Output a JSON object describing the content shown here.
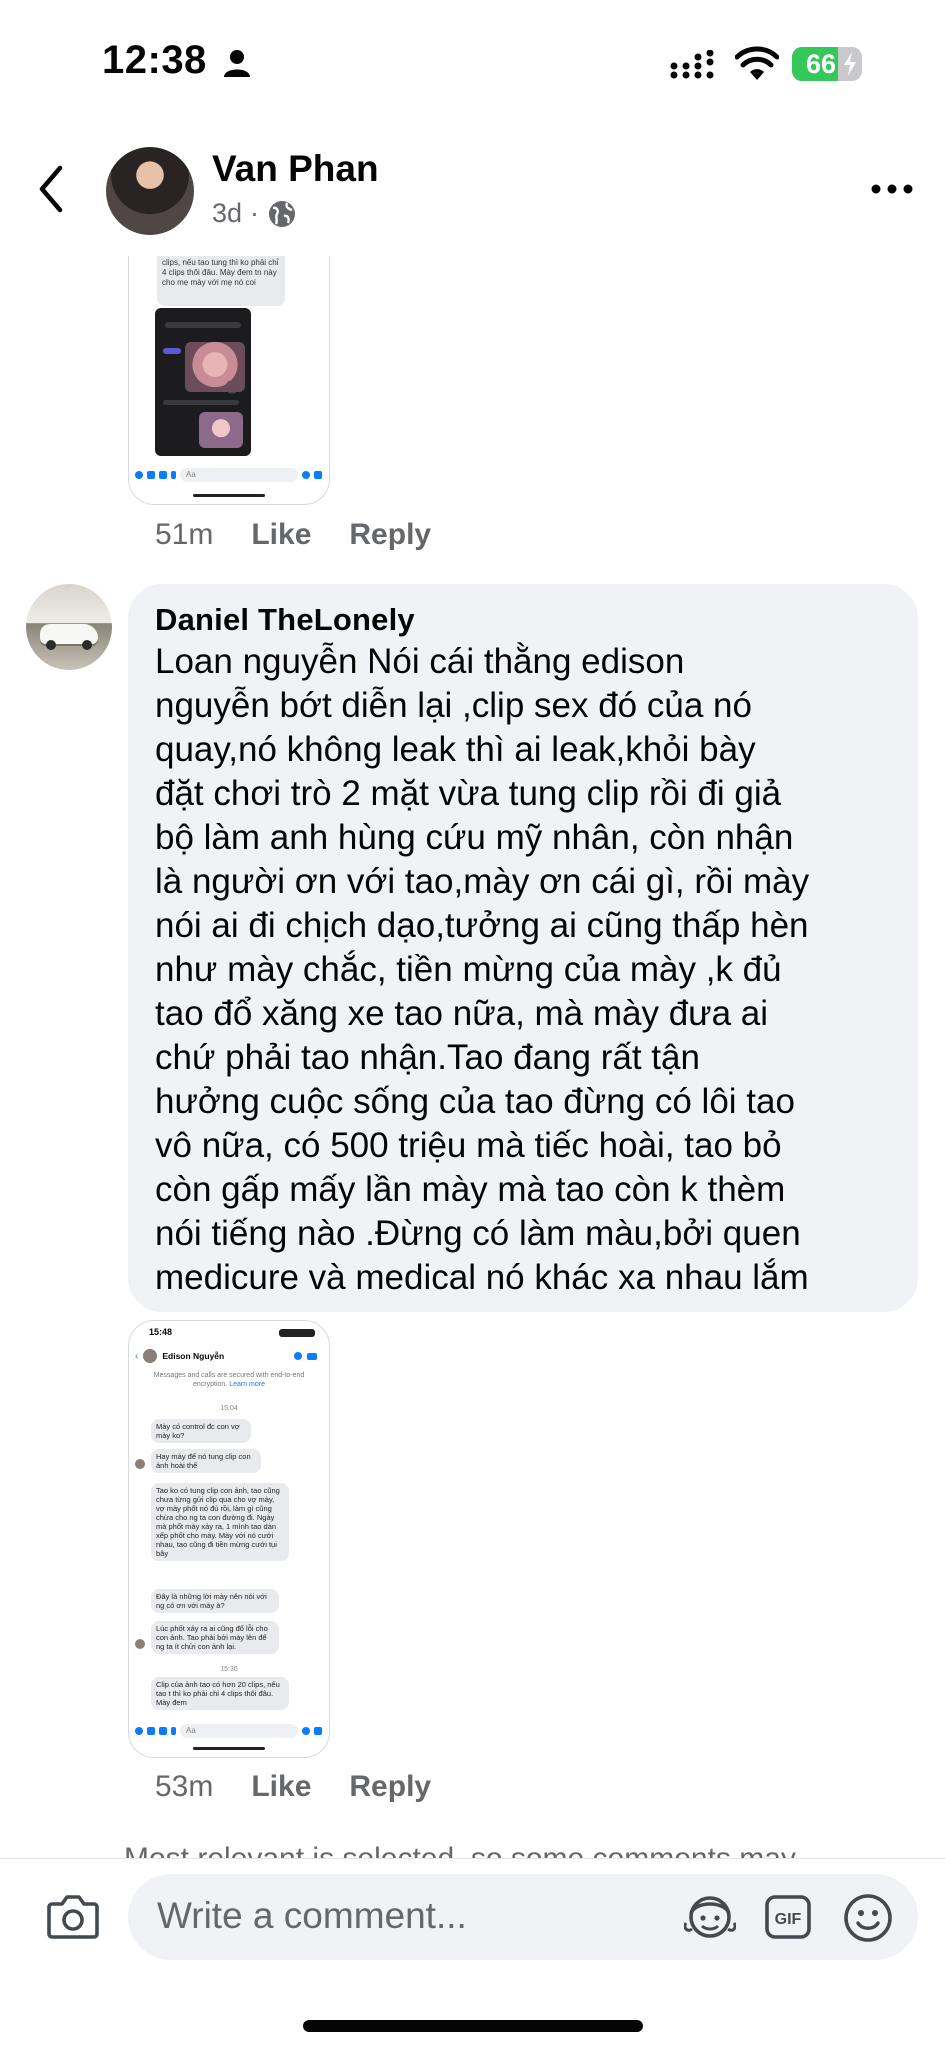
{
  "status_bar": {
    "time": "12:38",
    "battery": "66"
  },
  "header": {
    "name": "Van Phan",
    "time": "3d",
    "separator": "·"
  },
  "comment1": {
    "timestamp": "51m",
    "like": "Like",
    "reply": "Reply"
  },
  "comment2": {
    "author": "Daniel TheLonely",
    "text": "Loan nguyễn Nói cái thằng edison\nnguyễn  bớt diễn lại ,clip sex đó của nó\nquay,nó không leak thì ai leak,khỏi bày\nđặt chơi trò 2 mặt vừa tung clip rồi đi giả\nbộ làm anh hùng cứu mỹ nhân, còn nhận\nlà người ơn với tao,mày ơn cái gì, rồi mày\nnói ai đi chịch dạo,tưởng ai cũng thấp hèn\nnhư mày chắc, tiền mừng của  mày ,k đủ\ntao đổ xăng  xe tao nữa, mà mày đưa ai\nchứ phải  tao nhận.Tao đang rất tận\nhưởng cuộc sống của  tao đừng có lôi tao\nvô nữa, có  500 triệu mà tiếc  hoài, tao bỏ\ncòn gấp mấy lần mày mà tao còn k thèm\nnói  tiếng nào .Đừng có làm màu,bởi quen\nmedicure và medical nó khác xa nhau lắm",
    "timestamp": "53m",
    "like": "Like",
    "reply": "Reply"
  },
  "thumb1": {
    "bubble_text": "clips, nếu tao tung thì ko phải chỉ 4 clips thôi đâu. Mày đem tn này cho mẹ mày với mẹ nó coi",
    "input_placeholder": "Aa"
  },
  "thumb2": {
    "time": "15:48",
    "contact": "Edison Nguyễn",
    "encryption": "Messages and calls are secured with end-to-end encryption.",
    "learn_more": "Learn more",
    "stamp1": "15:04",
    "msg1": "Mày có control đc con vợ mày ko?",
    "msg2": "Hay mày để nó tung clip con ảnh hoài thế",
    "msg3": "Tao ko có tung clip con ảnh, tao cũng chưa từng gửi clip qua cho vợ mày, vợ mày phốt nó đủ rồi, làm gì cũng chừa cho ng ta con đường đi. Ngày mà phốt mày xảy ra, 1 mình tao dàn xếp phốt cho mày. Mày với nó cưới nhau, tao cũng đi tiền mừng cưới tụi bây",
    "msg4": "Đây là những lời mày nên nói với ng có ơn với mày à?",
    "msg5": "Lúc phốt xảy ra ai cũng đổ lỗi cho con ảnh. Tao phải bởi mày lên để ng ta ít chửi con ảnh lại.",
    "stamp2": "15:36",
    "msg6": "Clip của ảnh tao có hơn 20 clips, nếu tao t  thì ko phải chỉ 4 clips thôi đâu. Mày đem",
    "input_placeholder": "Aa"
  },
  "notice": "Most relevant is selected, so some comments may",
  "composer": {
    "placeholder": "Write a comment..."
  },
  "icons": [
    "person-icon",
    "signal-icon",
    "wifi-icon",
    "battery-icon",
    "back-icon",
    "globe-icon",
    "more-icon",
    "camera-icon",
    "avatar-sticker-icon",
    "gif-icon",
    "emoji-icon"
  ],
  "colors": {
    "text": "#050505",
    "secondary": "#65676b",
    "bubble": "#f0f2f5",
    "battery": "#34c759",
    "messenger_blue": "#0a7cff"
  }
}
